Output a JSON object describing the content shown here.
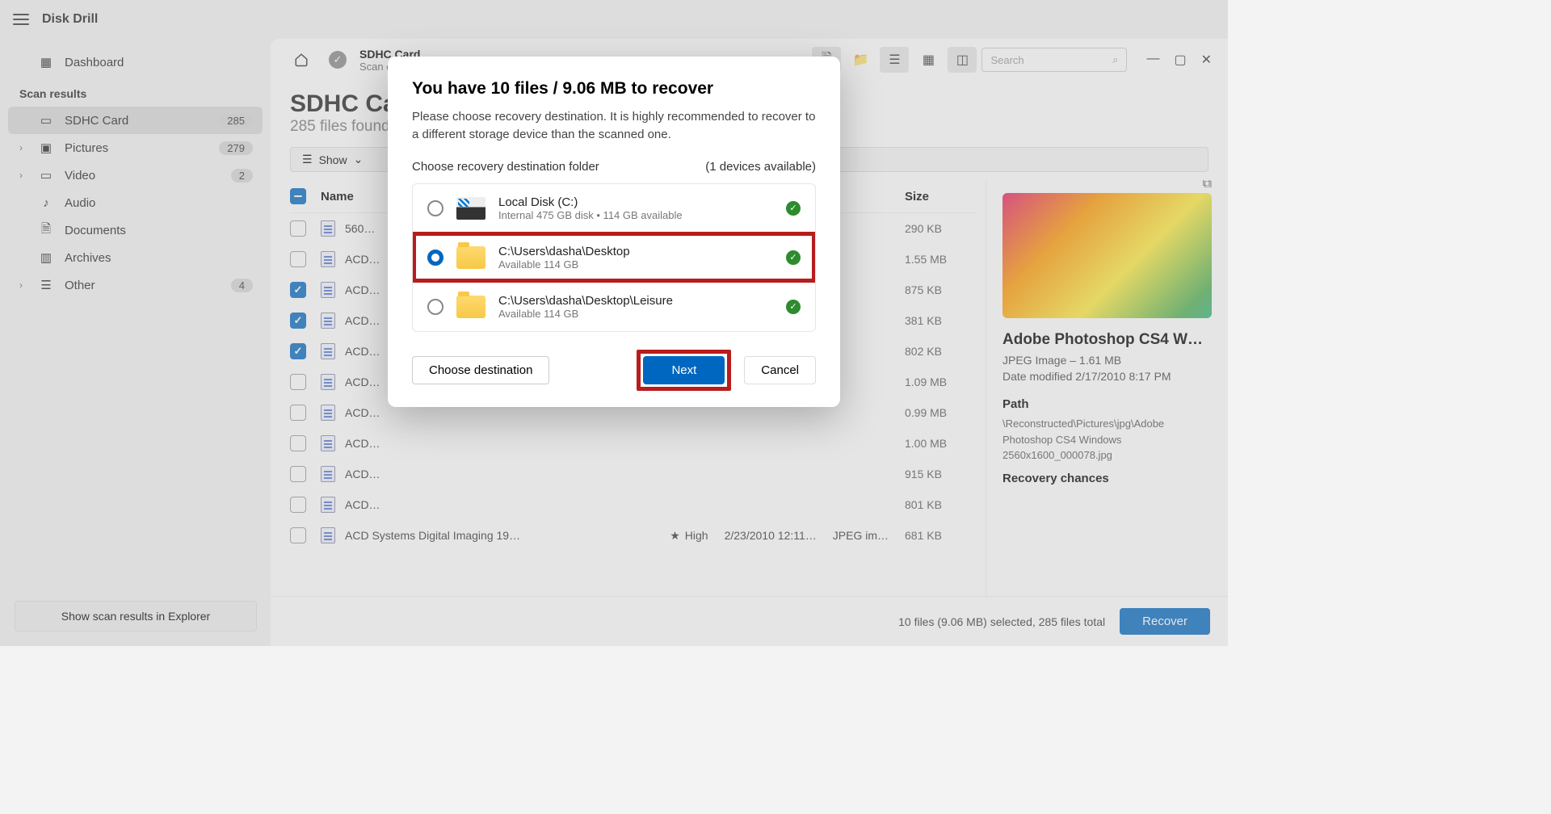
{
  "app": {
    "title": "Disk Drill"
  },
  "sidebar": {
    "dashboard": "Dashboard",
    "section": "Scan results",
    "items": [
      {
        "label": "SDHC Card",
        "badge": "285",
        "active": true,
        "icon": "drive",
        "chev": false
      },
      {
        "label": "Pictures",
        "badge": "279",
        "icon": "image",
        "chev": true
      },
      {
        "label": "Video",
        "badge": "2",
        "icon": "video",
        "chev": true
      },
      {
        "label": "Audio",
        "icon": "audio"
      },
      {
        "label": "Documents",
        "icon": "doc"
      },
      {
        "label": "Archives",
        "icon": "archive"
      },
      {
        "label": "Other",
        "badge": "4",
        "icon": "other",
        "chev": true
      }
    ],
    "explorer_btn": "Show scan results in Explorer"
  },
  "header": {
    "crumb_title": "SDHC Card",
    "crumb_sub": "Scan completed successfully",
    "search_placeholder": "Search"
  },
  "page": {
    "title": "SDHC Card",
    "subtitle": "285 files found",
    "show_btn": "Show"
  },
  "table": {
    "name_header": "Name",
    "size_header": "Size",
    "rows": [
      {
        "name": "560…",
        "size": "290 KB",
        "checked": false
      },
      {
        "name": "ACD…",
        "size": "1.55 MB",
        "checked": false
      },
      {
        "name": "ACD…",
        "size": "875 KB",
        "checked": true
      },
      {
        "name": "ACD…",
        "size": "381 KB",
        "checked": true
      },
      {
        "name": "ACD…",
        "size": "802 KB",
        "checked": true
      },
      {
        "name": "ACD…",
        "size": "1.09 MB",
        "checked": false
      },
      {
        "name": "ACD…",
        "size": "0.99 MB",
        "checked": false
      },
      {
        "name": "ACD…",
        "size": "1.00 MB",
        "checked": false
      },
      {
        "name": "ACD…",
        "size": "915 KB",
        "checked": false
      },
      {
        "name": "ACD…",
        "size": "801 KB",
        "checked": false
      }
    ],
    "last_row": {
      "name": "ACD Systems Digital Imaging 19…",
      "chance": "High",
      "date": "2/23/2010 12:11…",
      "kind": "JPEG im…",
      "size": "681 KB"
    }
  },
  "details": {
    "title": "Adobe Photoshop CS4 W…",
    "subtitle": "JPEG Image – 1.61 MB",
    "modified": "Date modified 2/17/2010 8:17 PM",
    "path_label": "Path",
    "path": "\\Reconstructed\\Pictures\\jpg\\Adobe Photoshop CS4 Windows 2560x1600_000078.jpg",
    "chances_label": "Recovery chances"
  },
  "footer": {
    "status": "10 files (9.06 MB) selected, 285 files total",
    "recover": "Recover"
  },
  "modal": {
    "title": "You have 10 files / 9.06 MB to recover",
    "text": "Please choose recovery destination. It is highly recommended to recover to a different storage device than the scanned one.",
    "choose_label": "Choose recovery destination folder",
    "devices": "(1 devices available)",
    "dests": [
      {
        "title": "Local Disk (C:)",
        "sub": "Internal 475 GB disk • 114 GB available",
        "icon": "drive",
        "selected": false
      },
      {
        "title": "C:\\Users\\dasha\\Desktop",
        "sub": "Available 114 GB",
        "icon": "folder",
        "selected": true,
        "highlight": true
      },
      {
        "title": "C:\\Users\\dasha\\Desktop\\Leisure",
        "sub": "Available 114 GB",
        "icon": "folder",
        "selected": false
      }
    ],
    "choose_btn": "Choose destination",
    "next_btn": "Next",
    "cancel_btn": "Cancel"
  }
}
